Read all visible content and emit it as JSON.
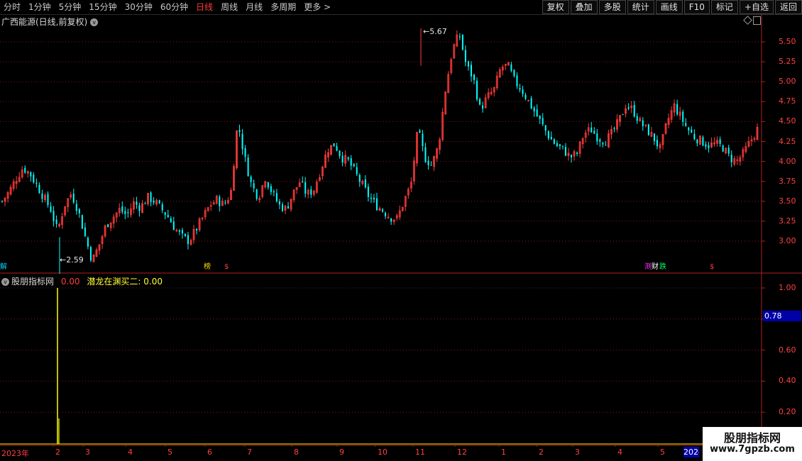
{
  "toolbar": {
    "periods": [
      "分时",
      "1分钟",
      "5分钟",
      "15分钟",
      "30分钟",
      "60分钟",
      "日线",
      "周线",
      "月线",
      "多周期",
      "更多 >"
    ],
    "active_period": "日线",
    "tools": [
      "复权",
      "叠加",
      "多股",
      "统计",
      "画线",
      "F10",
      "标记",
      "+自选",
      "返回"
    ]
  },
  "main_chart": {
    "title": "广西能源(日线,前复权)",
    "price_ticks": [
      "5.50",
      "5.25",
      "5.00",
      "4.75",
      "4.50",
      "4.25",
      "4.00",
      "3.75",
      "3.50",
      "3.25",
      "3.00"
    ],
    "high_label": "5.67",
    "low_label": "2.59",
    "markers": [
      {
        "text": "解",
        "color": "#00d0ff"
      },
      {
        "text": "榜",
        "color": "#ffd700"
      },
      {
        "text": "$",
        "color": "#ff3b3b"
      },
      {
        "text": "测",
        "color": "#ff3bff"
      },
      {
        "text": "财",
        "color": "#ffffff"
      },
      {
        "text": "跌",
        "color": "#00ff66"
      },
      {
        "text": "$",
        "color": "#ff3b3b"
      }
    ]
  },
  "indicator": {
    "name": "股朋指标网",
    "value1": "0.00",
    "series2_label": "潜龙在渊买二: 0.00",
    "ticks": [
      "1.00",
      "0.60",
      "0.40",
      "0.20"
    ],
    "current_value": "0.78"
  },
  "x_axis": {
    "labels": [
      "2023年",
      "2",
      "3",
      "4",
      "5",
      "6",
      "7",
      "8",
      "9",
      "10",
      "11",
      "12",
      "1",
      "2",
      "3",
      "4",
      "5"
    ],
    "year_box": "2024"
  },
  "watermark": {
    "line1": "股朋指标网",
    "line2": "www.7gpzb.com"
  },
  "colors": {
    "up": "#ff3b3b",
    "down": "#00ffff",
    "signal": "#ffff00"
  },
  "chart_data": {
    "type": "candlestick",
    "y_range": [
      2.55,
      5.75
    ],
    "extremes": {
      "high": 5.67,
      "low": 2.59
    },
    "close_path": [
      3.5,
      3.62,
      3.78,
      3.92,
      3.85,
      3.7,
      3.55,
      3.4,
      3.12,
      3.45,
      3.6,
      3.38,
      3.05,
      2.75,
      2.95,
      3.2,
      3.3,
      3.4,
      3.32,
      3.48,
      3.42,
      3.55,
      3.5,
      3.4,
      3.3,
      3.15,
      3.05,
      3.0,
      3.15,
      3.3,
      3.45,
      3.52,
      3.45,
      3.6,
      4.5,
      4.05,
      3.7,
      3.55,
      3.8,
      3.6,
      3.45,
      3.4,
      3.6,
      3.75,
      3.58,
      3.65,
      3.9,
      4.15,
      4.22,
      4.05,
      4.0,
      3.85,
      3.7,
      3.55,
      3.45,
      3.38,
      3.3,
      3.28,
      3.5,
      3.7,
      4.4,
      4.05,
      3.95,
      4.2,
      4.9,
      5.4,
      5.6,
      5.2,
      5.05,
      4.65,
      4.8,
      4.9,
      5.18,
      5.2,
      5.0,
      4.9,
      4.75,
      4.6,
      4.45,
      4.3,
      4.2,
      4.15,
      4.05,
      4.1,
      4.35,
      4.4,
      4.3,
      4.25,
      4.35,
      4.5,
      4.7,
      4.65,
      4.5,
      4.4,
      4.3,
      4.15,
      4.5,
      4.7,
      4.55,
      4.4,
      4.3,
      4.25,
      4.2,
      4.22,
      4.18,
      4.05,
      4.0,
      4.1,
      4.25,
      4.4
    ],
    "indicator": {
      "series": "股朋指标网",
      "spike_date_index": 2,
      "spike_value": 1.0,
      "y_range": [
        0,
        1.05
      ]
    }
  }
}
